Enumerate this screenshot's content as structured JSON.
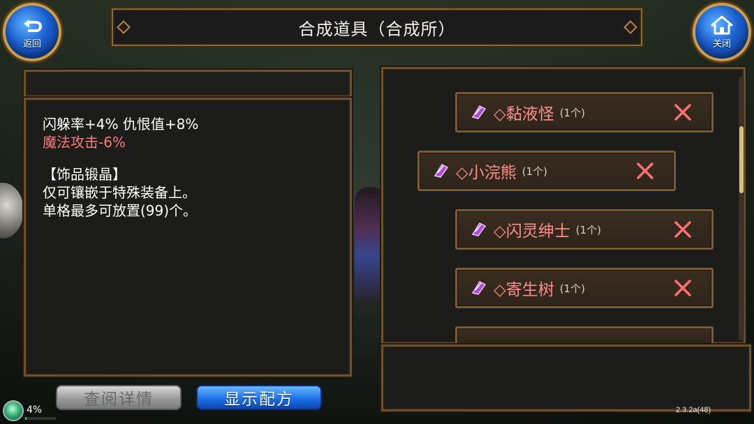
{
  "header": {
    "title": "合成道具（合成所）"
  },
  "nav": {
    "back_label": "返回",
    "back_icon": "return-arrow-icon",
    "close_label": "关闭",
    "close_icon": "home-icon"
  },
  "description": {
    "line1": "闪躲率+4% 仇恨值+8%",
    "line2": "魔法攻击-6%",
    "line3": "【饰品锻晶】",
    "line4": "仅可镶嵌于特殊装备上。",
    "line5": "单格最多可放置(99)个。",
    "colors": {
      "normal": "#ffffff",
      "negative": "#ff7b7b"
    }
  },
  "ingredients": {
    "items": [
      {
        "name": "◇黏液怪",
        "count": "(1个)"
      },
      {
        "name": "◇小浣熊",
        "count": "(1个)"
      },
      {
        "name": "◇闪灵绅士",
        "count": "(1个)"
      },
      {
        "name": "◇寄生树",
        "count": "(1个)"
      }
    ],
    "item_icon": "purple-crystal-icon",
    "remove_icon": "close-x-icon",
    "scroll_position": 0.25
  },
  "buttons": {
    "details_label": "查阅详情",
    "recipe_label": "显示配方"
  },
  "status": {
    "percent": "4%",
    "percent_value": 0.04,
    "version": "2.3.2a(48)"
  },
  "colors": {
    "accent_blue": "#1d70e8",
    "frame_gold": "#8a6a3a",
    "item_name": "#ff8c8c"
  }
}
